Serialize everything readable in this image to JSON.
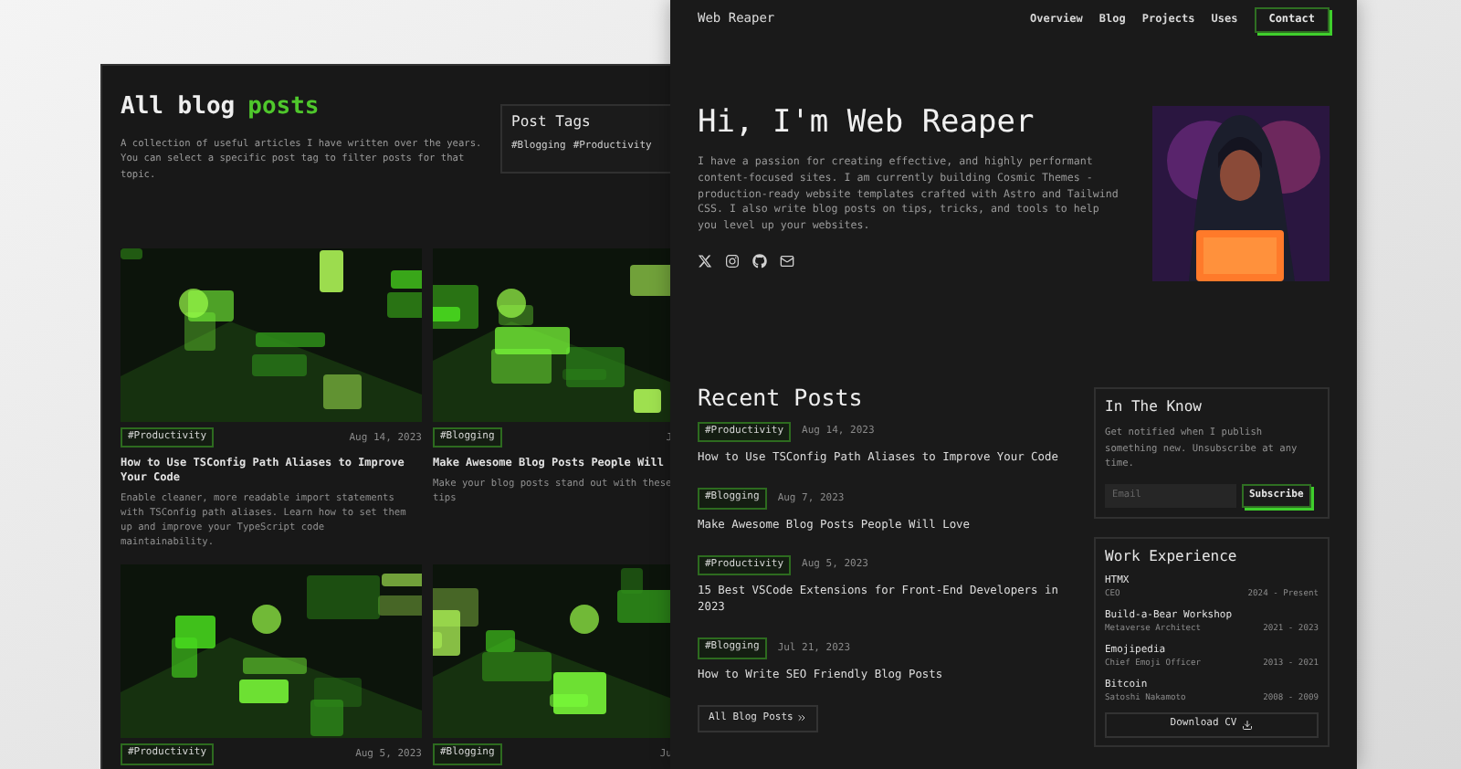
{
  "blog_window": {
    "heading": {
      "text": "All blog",
      "accent": "posts"
    },
    "description": "A collection of useful articles I have written over the years. You can select a specific post tag to filter posts for that topic.",
    "post_tags": {
      "title": "Post Tags",
      "tags": [
        "#Blogging",
        "#Productivity"
      ]
    },
    "cards": [
      {
        "tag": "#Productivity",
        "date": "Aug 14, 2023",
        "title": "How to Use TSConfig Path Aliases to Improve Your Code",
        "excerpt": "Enable cleaner, more readable import statements with TSConfig path aliases. Learn how to set them up and improve your TypeScript code maintainability."
      },
      {
        "tag": "#Blogging",
        "date": "J",
        "title": "Make Awesome Blog Posts People Will",
        "excerpt": "Make your blog posts stand out with these tips"
      },
      {
        "tag": "#Productivity",
        "date": "Aug 5, 2023"
      },
      {
        "tag": "#Blogging",
        "date": "Ju"
      }
    ]
  },
  "home_window": {
    "site_name": "Web Reaper",
    "nav": [
      {
        "label": "Overview",
        "kind": "link"
      },
      {
        "label": "Blog",
        "kind": "link"
      },
      {
        "label": "Projects",
        "kind": "link"
      },
      {
        "label": "Uses",
        "kind": "link"
      },
      {
        "label": "Contact",
        "kind": "button"
      }
    ],
    "hero": {
      "heading": "Hi, I'm Web Reaper",
      "intro": "I have a passion for creating effective, and highly performant content-focused sites. I am currently building Cosmic Themes - production-ready website templates crafted with Astro and Tailwind CSS. I also write blog posts on tips, tricks, and tools to help you level up your websites."
    },
    "recent_posts": {
      "heading": "Recent Posts",
      "posts": [
        {
          "tag": "#Productivity",
          "date": "Aug 14, 2023",
          "title": "How to Use TSConfig Path Aliases to Improve Your Code"
        },
        {
          "tag": "#Blogging",
          "date": "Aug 7, 2023",
          "title": "Make Awesome Blog Posts People Will Love"
        },
        {
          "tag": "#Productivity",
          "date": "Aug 5, 2023",
          "title": "15 Best VSCode Extensions for Front-End Developers in 2023"
        },
        {
          "tag": "#Blogging",
          "date": "Jul 21, 2023",
          "title": "How to Write SEO Friendly Blog Posts"
        }
      ],
      "all_button": "All Blog Posts"
    },
    "newsletter": {
      "title": "In The Know",
      "text": "Get notified when I publish something new. Unsubscribe at any time.",
      "placeholder": "Email",
      "button": "Subscribe"
    },
    "work": {
      "title": "Work Experience",
      "jobs": [
        {
          "company": "HTMX",
          "role": "CEO",
          "period": "2024 - Present"
        },
        {
          "company": "Build-a-Bear Workshop",
          "role": "Metaverse Architect",
          "period": "2021 - 2023"
        },
        {
          "company": "Emojipedia",
          "role": "Chief Emoji Officer",
          "period": "2013 - 2021"
        },
        {
          "company": "Bitcoin",
          "role": "Satoshi Nakamoto",
          "period": "2008 - 2009"
        }
      ],
      "download": "Download CV"
    }
  }
}
